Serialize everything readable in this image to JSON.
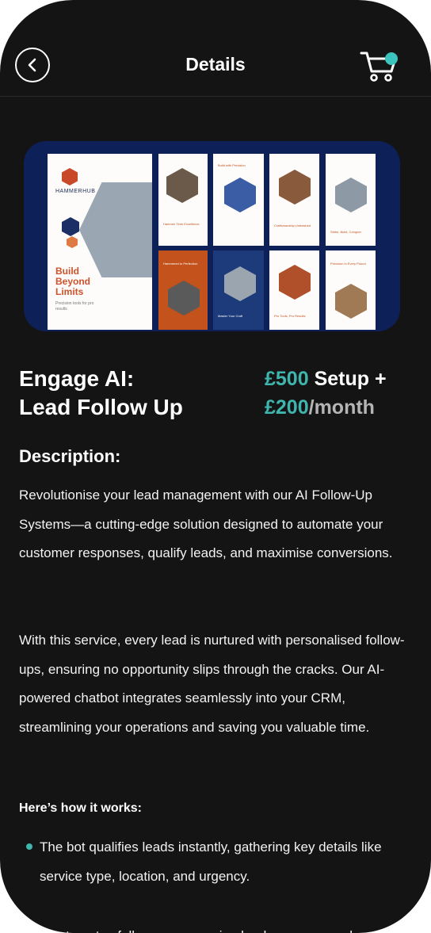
{
  "header": {
    "title": "Details",
    "back_icon": "chevron-left-icon",
    "cart_icon": "cart-icon",
    "cart_badge_color": "#3cc3bd"
  },
  "hero": {
    "brand": "HAMMERHUB",
    "headline": "Build Beyond Limits",
    "subline": "Precision tools for pro results",
    "mini_cards": [
      "Hammer Time Excellence",
      "Build with Precision",
      "Craftsmanship Unleashed",
      "Strike, Build, Conquer",
      "Hammered to Perfection",
      "Master Your Craft",
      "Pro Tools, Pro Results",
      "Precision in Every Pound"
    ]
  },
  "product": {
    "title_line1": "Engage AI:",
    "title_line2": "Lead Follow Up",
    "setup_price": "£500",
    "setup_label": " Setup +",
    "monthly_price": "£200",
    "monthly_label": "/month"
  },
  "description": {
    "heading": "Description:",
    "paragraph1": "Revolutionise your lead management with our AI Follow-Up Systems—a cutting-edge solution designed to automate your customer responses, qualify leads, and maximise conversions.",
    "paragraph2": "With this service, every lead is nurtured with personalised follow-ups, ensuring no opportunity slips through the cracks. Our AI-powered chatbot integrates seamlessly into your CRM, streamlining your operations and saving you valuable time.",
    "how_heading": "Here’s how it works:",
    "bullets": [
      "The bot qualifies leads instantly, gathering key details like service type, location, and urgency.",
      "It automates follow-ups, ensuring leads are engaged..."
    ]
  },
  "colors": {
    "background": "#141414",
    "accent": "#3fb6ad"
  }
}
